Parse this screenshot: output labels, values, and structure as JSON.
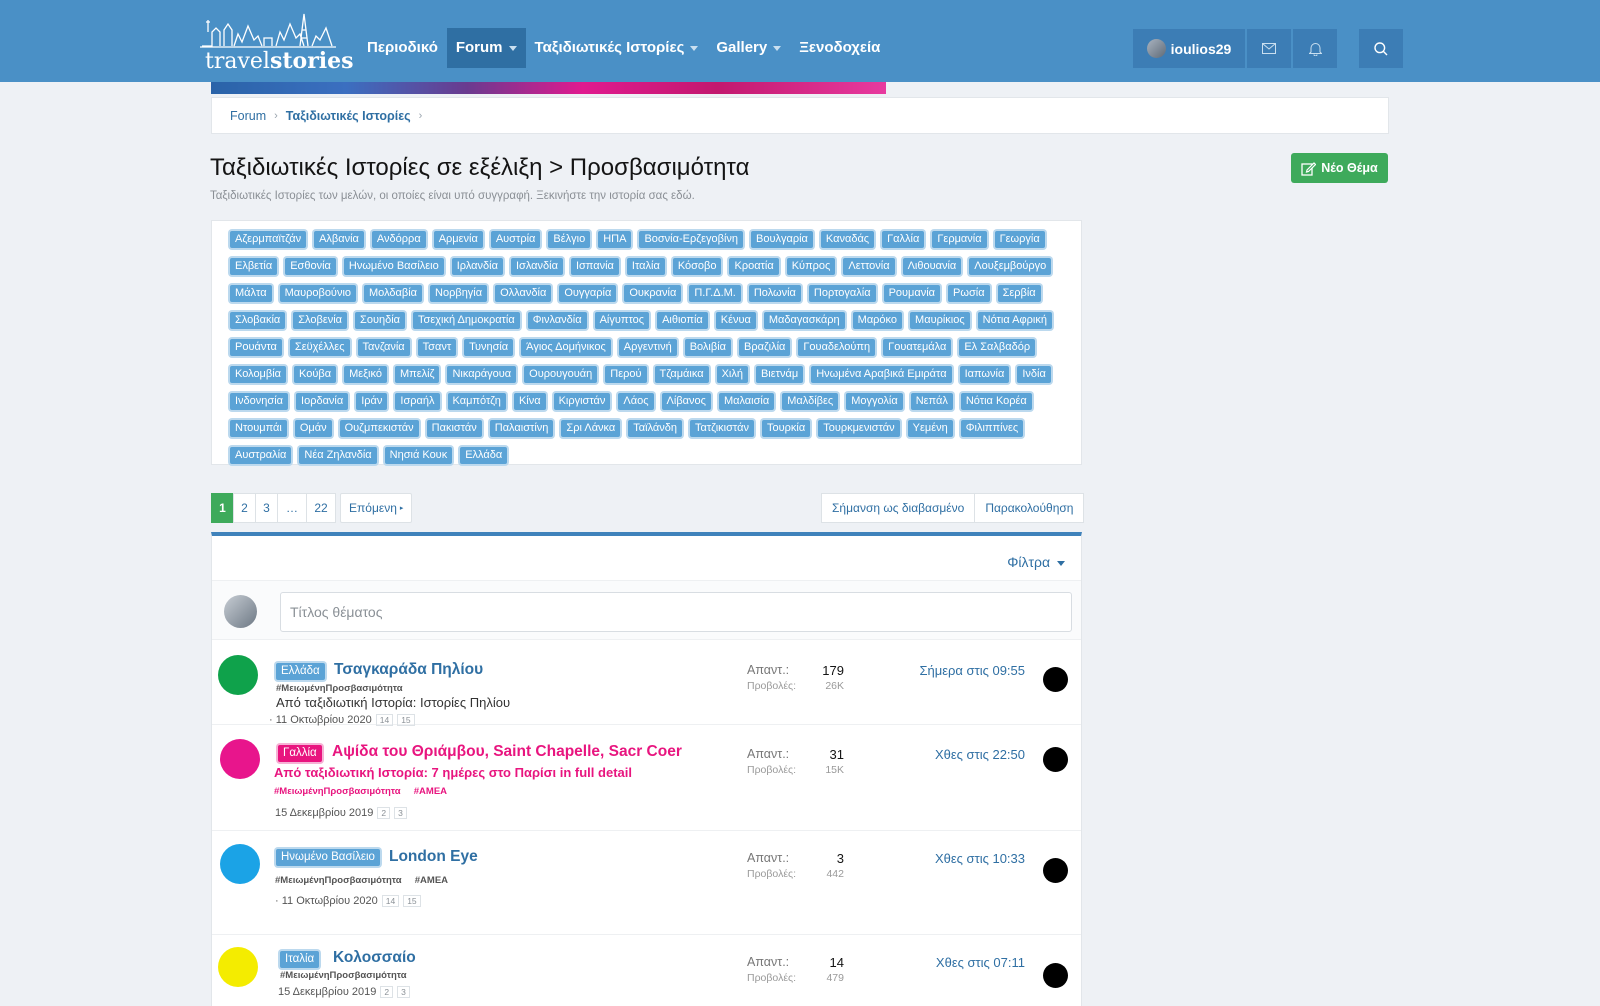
{
  "header": {
    "logo_text_light": "travel",
    "logo_text_bold": "stories",
    "nav": [
      {
        "label": "Περιοδικό",
        "caret": false,
        "active": false
      },
      {
        "label": "Forum",
        "caret": true,
        "active": true
      },
      {
        "label": "Ταξιδιωτικές Ιστορίες",
        "caret": true,
        "active": false
      },
      {
        "label": "Gallery",
        "caret": true,
        "active": false
      },
      {
        "label": "Ξενοδοχεία",
        "caret": false,
        "active": false
      }
    ],
    "username": "ioulios29"
  },
  "breadcrumb": {
    "items": [
      "Forum",
      "Ταξιδιωτικές Ιστορίες"
    ]
  },
  "page": {
    "title": "Ταξιδιωτικές Ιστορίες σε εξέλιξη > Προσβασιμότητα",
    "description": "Ταξιδιωτικές Ιστορίες των μελών, οι οποίες είναι υπό συγγραφή. Ξεκινήστε την ιστορία σας εδώ.",
    "new_thread_label": "Νέο Θέμα"
  },
  "tags": [
    "Αζερμπαϊτζάν",
    "Αλβανία",
    "Ανδόρρα",
    "Αρμενία",
    "Αυστρία",
    "Βέλγιο",
    "ΗΠΑ",
    "Βοσνία-Ερζεγοβίνη",
    "Βουλγαρία",
    "Καναδάς",
    "Γαλλία",
    "Γερμανία",
    "Γεωργία",
    "Ελβετία",
    "Εσθονία",
    "Ηνωμένο Βασίλειο",
    "Ιρλανδία",
    "Ισλανδία",
    "Ισπανία",
    "Ιταλία",
    "Κόσοβο",
    "Κροατία",
    "Κύπρος",
    "Λεττονία",
    "Λιθουανία",
    "Λουξεμβούργο",
    "Μάλτα",
    "Μαυροβούνιο",
    "Μολδαβία",
    "Νορβηγία",
    "Ολλανδία",
    "Ουγγαρία",
    "Ουκρανία",
    "Π.Γ.Δ.Μ.",
    "Πολωνία",
    "Πορτογαλία",
    "Ρουμανία",
    "Ρωσία",
    "Σερβία",
    "Σλοβακία",
    "Σλοβενία",
    "Σουηδία",
    "Τσεχική Δημοκρατία",
    "Φινλανδία",
    "Αίγυπτος",
    "Αιθιοπία",
    "Κένυα",
    "Μαδαγασκάρη",
    "Μαρόκο",
    "Μαυρίκιος",
    "Νότια Αφρική",
    "Ρουάντα",
    "Σεϋχέλλες",
    "Τανζανία",
    "Τσαντ",
    "Τυνησία",
    "Άγιος Δομήνικος",
    "Αργεντινή",
    "Βολιβία",
    "Βραζιλία",
    "Γουαδελούπη",
    "Γουατεμάλα",
    "Ελ Σαλβαδόρ",
    "Κολομβία",
    "Κούβα",
    "Μεξικό",
    "Μπελίζ",
    "Νικαράγουα",
    "Ουρουγουάη",
    "Περού",
    "Τζαμάικα",
    "Χιλή",
    "Βιετνάμ",
    "Ηνωμένα Αραβικά Εμιράτα",
    "Ιαπωνία",
    "Ινδία",
    "Ινδονησία",
    "Ιορδανία",
    "Ιράν",
    "Ισραήλ",
    "Καμπότζη",
    "Κίνα",
    "Κιργιστάν",
    "Λάος",
    "Λίβανος",
    "Μαλαισία",
    "Μαλδίβες",
    "Μογγολία",
    "Νεπάλ",
    "Νότια Κορέα",
    "Ντουμπάι",
    "Ομάν",
    "Ουζμπεκιστάν",
    "Πακιστάν",
    "Παλαιστίνη",
    "Σρι Λάνκα",
    "Ταϊλάνδη",
    "Τατζικιστάν",
    "Τουρκία",
    "Τουρκμενιστάν",
    "Υεμένη",
    "Φιλιππίνες",
    "Αυστραλία",
    "Νέα Ζηλανδία",
    "Νησιά Κουκ",
    "Ελλάδα"
  ],
  "pagination": {
    "pages": [
      "1",
      "2",
      "3",
      "…",
      "22"
    ],
    "next_label": "Επόμενη"
  },
  "actions": {
    "mark_read": "Σήμανση ως διαβασμένο",
    "watch": "Παρακολούθηση"
  },
  "list": {
    "filters_label": "Φίλτρα",
    "quick_placeholder": "Τίτλος θέματος",
    "replies_label": "Απαντ.:",
    "views_label": "Προβολές:"
  },
  "threads": [
    {
      "avatar_color": "#0fa24b",
      "prefix": "Ελλάδα",
      "title": "Τσαγκαράδα Πηλίου",
      "hashtags": "#ΜειωμένηΠροσβασιμότητα",
      "from": "Από ταξιδιωτική Ιστορία: Ιστορίες Πηλίου",
      "date": "· 11 Οκτωβρίου 2020",
      "pages": [
        "14",
        "15"
      ],
      "replies": "179",
      "views": "26K",
      "last": "Σήμερα στις 09:55",
      "pink": false
    },
    {
      "avatar_color": "#e8158c",
      "prefix": "Γαλλία",
      "title": "Αψίδα του Θριάμβου, Saint Chapelle, Sacr Coer",
      "hashtags": "#ΜειωμένηΠροσβασιμότητα     #ΑΜΕΑ",
      "from": "Από ταξιδιωτική Ιστορία: 7 ημέρες στο Παρίσι in full detail",
      "date": "15 Δεκεμβρίου 2019",
      "pages": [
        "2",
        "3"
      ],
      "replies": "31",
      "views": "15K",
      "last": "Χθες στις 22:50",
      "pink": true
    },
    {
      "avatar_color": "#1ba3e6",
      "prefix": "Ηνωμένο Βασίλειο",
      "title": "London Eye",
      "hashtags": "#ΜειωμένηΠροσβασιμότητα     #ΑΜΕΑ",
      "from": "",
      "date": "· 11 Οκτωβρίου 2020",
      "pages": [
        "14",
        "15"
      ],
      "replies": "3",
      "views": "442",
      "last": "Χθες στις 10:33",
      "pink": false
    },
    {
      "avatar_color": "#f4ec00",
      "prefix": "Ιταλία",
      "title": "Κολοσσαίο",
      "hashtags": "#ΜειωμένηΠροσβασιμότητα",
      "from": "",
      "date": "15 Δεκεμβρίου 2019",
      "pages": [
        "2",
        "3"
      ],
      "replies": "14",
      "views": "479",
      "last": "Χθες στις 07:11",
      "pink": false
    }
  ]
}
